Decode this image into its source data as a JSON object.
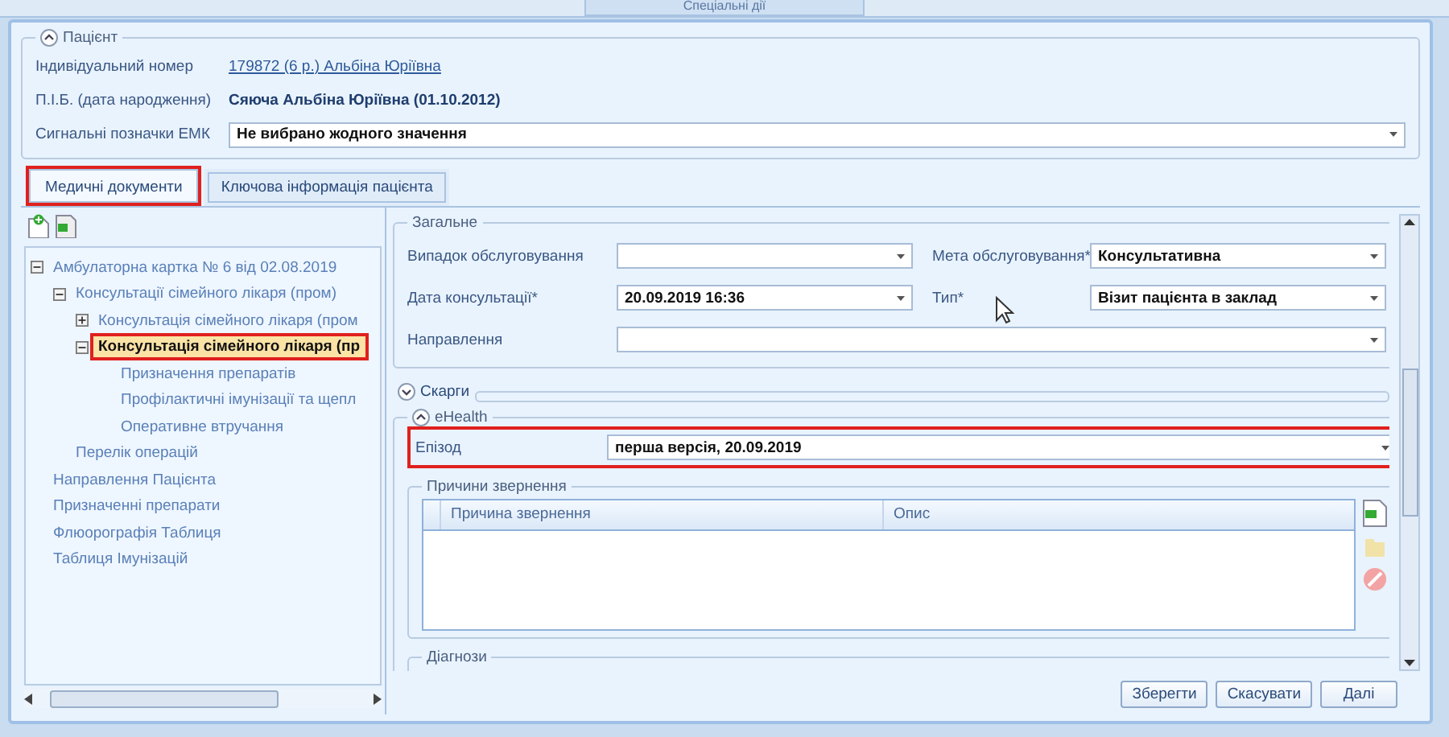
{
  "top_tab": {
    "label": "Спеціальні дії"
  },
  "patient": {
    "title": "Пацієнт",
    "expanded": true,
    "fields": [
      {
        "label": "Індивідуальний номер",
        "value": "179872 (6 р.) Альбіна Юріївна",
        "kind": "link"
      },
      {
        "label": "П.І.Б. (дата народження)",
        "value": "Сяюча Альбіна Юріївна (01.10.2012)",
        "kind": "bold"
      },
      {
        "label": "Сигнальні позначки ЕМК",
        "value": "Не вибрано жодного значення",
        "kind": "dropdown"
      }
    ]
  },
  "tabs": [
    {
      "label": "Медичні документи",
      "selected": true,
      "highlighted": true
    },
    {
      "label": "Ключова інформація пацієнта",
      "selected": false,
      "highlighted": false
    }
  ],
  "tree": [
    {
      "label": "Амбулаторна картка № 6 від 02.08.2019",
      "expanded": true,
      "selected": false,
      "highlighted": false,
      "children": [
        {
          "label": "Консультації сімейного лікаря (пром)",
          "expanded": true,
          "selected": false,
          "highlighted": false,
          "children": [
            {
              "label": "Консультація сімейного лікаря (пром",
              "expanded": false,
              "selected": false,
              "highlighted": false
            },
            {
              "label": "Консультація сімейного лікаря (пр",
              "expanded": true,
              "selected": true,
              "highlighted": true,
              "children": [
                {
                  "label": "Призначення препаратів",
                  "selected": false,
                  "highlighted": false
                },
                {
                  "label": "Профілактичні імунізації та щепл",
                  "selected": false,
                  "highlighted": false
                },
                {
                  "label": "Оперативне втручання",
                  "selected": false,
                  "highlighted": false
                }
              ]
            }
          ]
        },
        {
          "label": "Перелік операцій",
          "selected": false,
          "highlighted": false
        }
      ]
    },
    {
      "label": "Направлення Пацієнта",
      "selected": false,
      "highlighted": false
    },
    {
      "label": "Призначенні препарати",
      "selected": false,
      "highlighted": false
    },
    {
      "label": "Флюорографія Таблиця",
      "selected": false,
      "highlighted": false
    },
    {
      "label": "Таблиця Імунізацій",
      "selected": false,
      "highlighted": false
    }
  ],
  "general": {
    "title": "Загальне",
    "rows": [
      [
        {
          "label": "Випадок обслуговування"
        },
        {
          "label": "Мета обслуговування*",
          "value": "Консультативна"
        }
      ],
      [
        {
          "label": "Дата консультації*",
          "value": "20.09.2019 16:36"
        },
        {
          "label": "Тип*",
          "value": "Візит пацієнта в заклад"
        }
      ],
      [
        {
          "label": "Направлення"
        }
      ]
    ]
  },
  "complaints": {
    "title": "Скарги",
    "expanded": false
  },
  "ehealth": {
    "title": "eHealth",
    "expanded": true,
    "episode": {
      "label": "Епізод",
      "value": "перша версія, 20.09.2019",
      "highlighted": true
    },
    "reasons": {
      "title": "Причини звернення",
      "columns": [
        "Причина звернення",
        "Опис"
      ]
    },
    "diagnoses": {
      "title": "Діагнози"
    }
  },
  "buttons": [
    "Зберегти",
    "Скасувати",
    "Далі"
  ]
}
